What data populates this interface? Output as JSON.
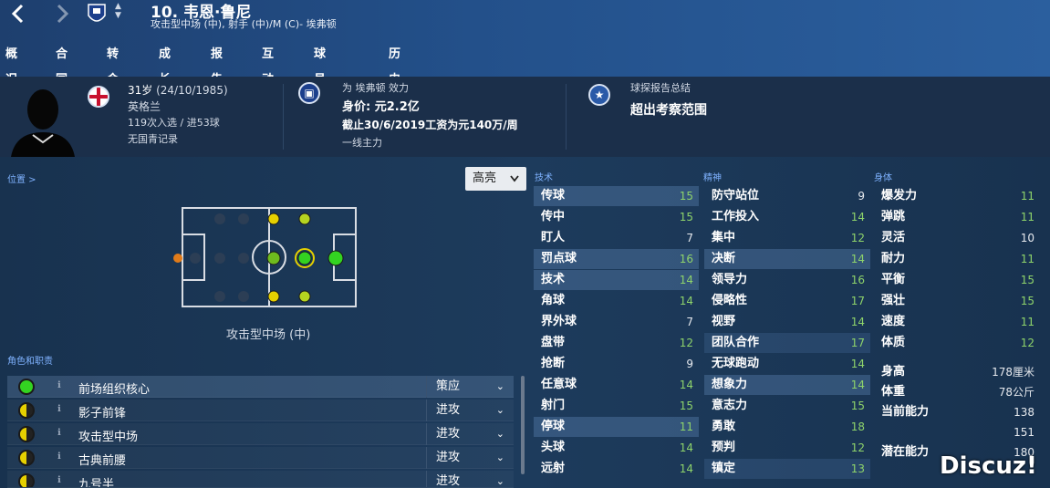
{
  "header": {
    "back_icon": "chevron-left-icon",
    "forward_icon": "chevron-right-icon",
    "club_crest_icon": "crest-icon",
    "title": "10. 韦恩·鲁尼",
    "subtitle": "攻击型中场 (中), 射手 (中)/M (C)- 埃弗顿"
  },
  "tabs": [
    {
      "label": "概况",
      "active": true
    },
    {
      "label": "合同"
    },
    {
      "label": "转会"
    },
    {
      "label": "成长"
    },
    {
      "label": "报告"
    },
    {
      "label": "互动"
    },
    {
      "label": "球员对比"
    },
    {
      "label": "历史"
    }
  ],
  "info": {
    "age": "31岁",
    "dob": "(24/10/1985)",
    "nation": "英格兰",
    "caps": "119次入选 / 进53球",
    "youth": "无国青记录",
    "club_line": "为 埃弗顿 效力",
    "value": "身价: 元2.2亿",
    "wage": "截止30/6/2019工资为元140万/周",
    "status": "一线主力",
    "scout_title": "球探报告总结",
    "scout_text": "超出考察范围"
  },
  "position_panel": {
    "label": "位置 >",
    "highlight_select": "高亮",
    "position_name": "攻击型中场 (中)"
  },
  "roles_panel": {
    "label": "角色和职责",
    "roles": [
      {
        "name": "前场组织核心",
        "duty": "策应",
        "icon": "full"
      },
      {
        "name": "影子前锋",
        "duty": "进攻",
        "icon": "half"
      },
      {
        "name": "攻击型中场",
        "duty": "进攻",
        "icon": "half"
      },
      {
        "name": "古典前腰",
        "duty": "进攻",
        "icon": "half"
      },
      {
        "name": "九号半",
        "duty": "进攻",
        "icon": "half"
      }
    ]
  },
  "attributes": {
    "technical_label": "技术",
    "mental_label": "精神",
    "physical_label": "身体",
    "technical": [
      {
        "name": "传球",
        "value": "15"
      },
      {
        "name": "传中",
        "value": "15"
      },
      {
        "name": "盯人",
        "value": "7"
      },
      {
        "name": "罚点球",
        "value": "16"
      },
      {
        "name": "技术",
        "value": "14"
      },
      {
        "name": "角球",
        "value": "14"
      },
      {
        "name": "界外球",
        "value": "7"
      },
      {
        "name": "盘带",
        "value": "12"
      },
      {
        "name": "抢断",
        "value": "9"
      },
      {
        "name": "任意球",
        "value": "14"
      },
      {
        "name": "射门",
        "value": "15"
      },
      {
        "name": "停球",
        "value": "11"
      },
      {
        "name": "头球",
        "value": "14"
      },
      {
        "name": "远射",
        "value": "14"
      }
    ],
    "mental": [
      {
        "name": "防守站位",
        "value": "9"
      },
      {
        "name": "工作投入",
        "value": "14"
      },
      {
        "name": "集中",
        "value": "12"
      },
      {
        "name": "决断",
        "value": "14"
      },
      {
        "name": "领导力",
        "value": "16"
      },
      {
        "name": "侵略性",
        "value": "17"
      },
      {
        "name": "视野",
        "value": "14"
      },
      {
        "name": "团队合作",
        "value": "17"
      },
      {
        "name": "无球跑动",
        "value": "14"
      },
      {
        "name": "想象力",
        "value": "14"
      },
      {
        "name": "意志力",
        "value": "15"
      },
      {
        "name": "勇敢",
        "value": "18"
      },
      {
        "name": "预判",
        "value": "12"
      },
      {
        "name": "镇定",
        "value": "13"
      }
    ],
    "physical": [
      {
        "name": "爆发力",
        "value": "11"
      },
      {
        "name": "弹跳",
        "value": "11"
      },
      {
        "name": "灵活",
        "value": "10"
      },
      {
        "name": "耐力",
        "value": "11"
      },
      {
        "name": "平衡",
        "value": "15"
      },
      {
        "name": "强壮",
        "value": "15"
      },
      {
        "name": "速度",
        "value": "11"
      },
      {
        "name": "体质",
        "value": "12"
      }
    ],
    "extra": [
      {
        "name": "身高",
        "value": "178厘米"
      },
      {
        "name": "体重",
        "value": "78公斤"
      },
      {
        "name": "当前能力",
        "value": "138"
      },
      {
        "name": "",
        "value": "151"
      },
      {
        "name": "潜在能力",
        "value": "180"
      }
    ]
  },
  "watermark": "Discuz!"
}
